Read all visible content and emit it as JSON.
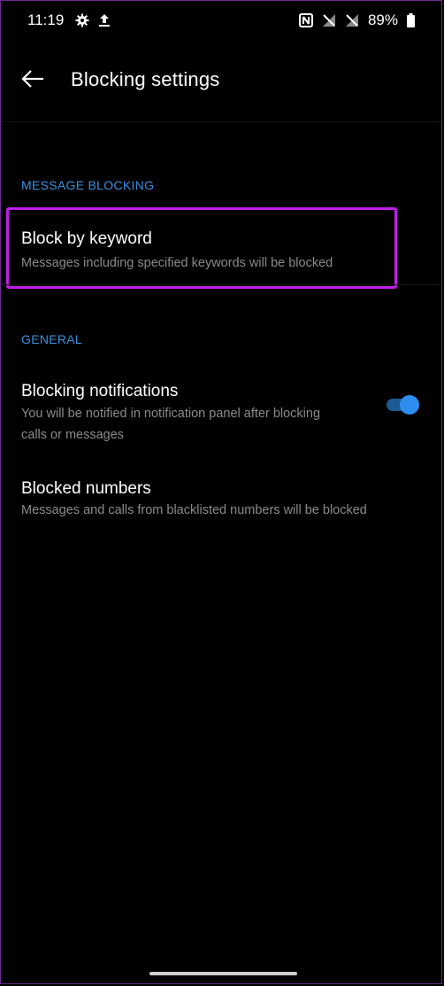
{
  "status_bar": {
    "time": "11:19",
    "battery": "89%",
    "icons_left": [
      "settings-gear-icon",
      "upload-arrow-icon"
    ],
    "icons_right": [
      "nfc-icon",
      "signal-off-icon",
      "signal-off-icon",
      "battery-icon"
    ]
  },
  "toolbar": {
    "title": "Blocking settings",
    "back_icon": "back-arrow-icon"
  },
  "sections": {
    "message_blocking": {
      "header": "MESSAGE BLOCKING",
      "items": [
        {
          "title": "Block by keyword",
          "summary": "Messages including specified keywords will be blocked"
        }
      ]
    },
    "general": {
      "header": "GENERAL",
      "items": [
        {
          "title": "Blocking notifications",
          "summary_line1": "You will be notified in notification panel after blocking",
          "summary_line2": "calls or messages",
          "toggle_on": true
        },
        {
          "title": "Blocked numbers",
          "summary": "Messages and calls from blacklisted numbers will be blocked"
        }
      ]
    }
  },
  "colors": {
    "background": "#000000",
    "accent": "#2d8ef0",
    "section_header": "#3a8fe0",
    "highlight": "#c21ee8",
    "secondary_text": "#8a8a8a"
  }
}
